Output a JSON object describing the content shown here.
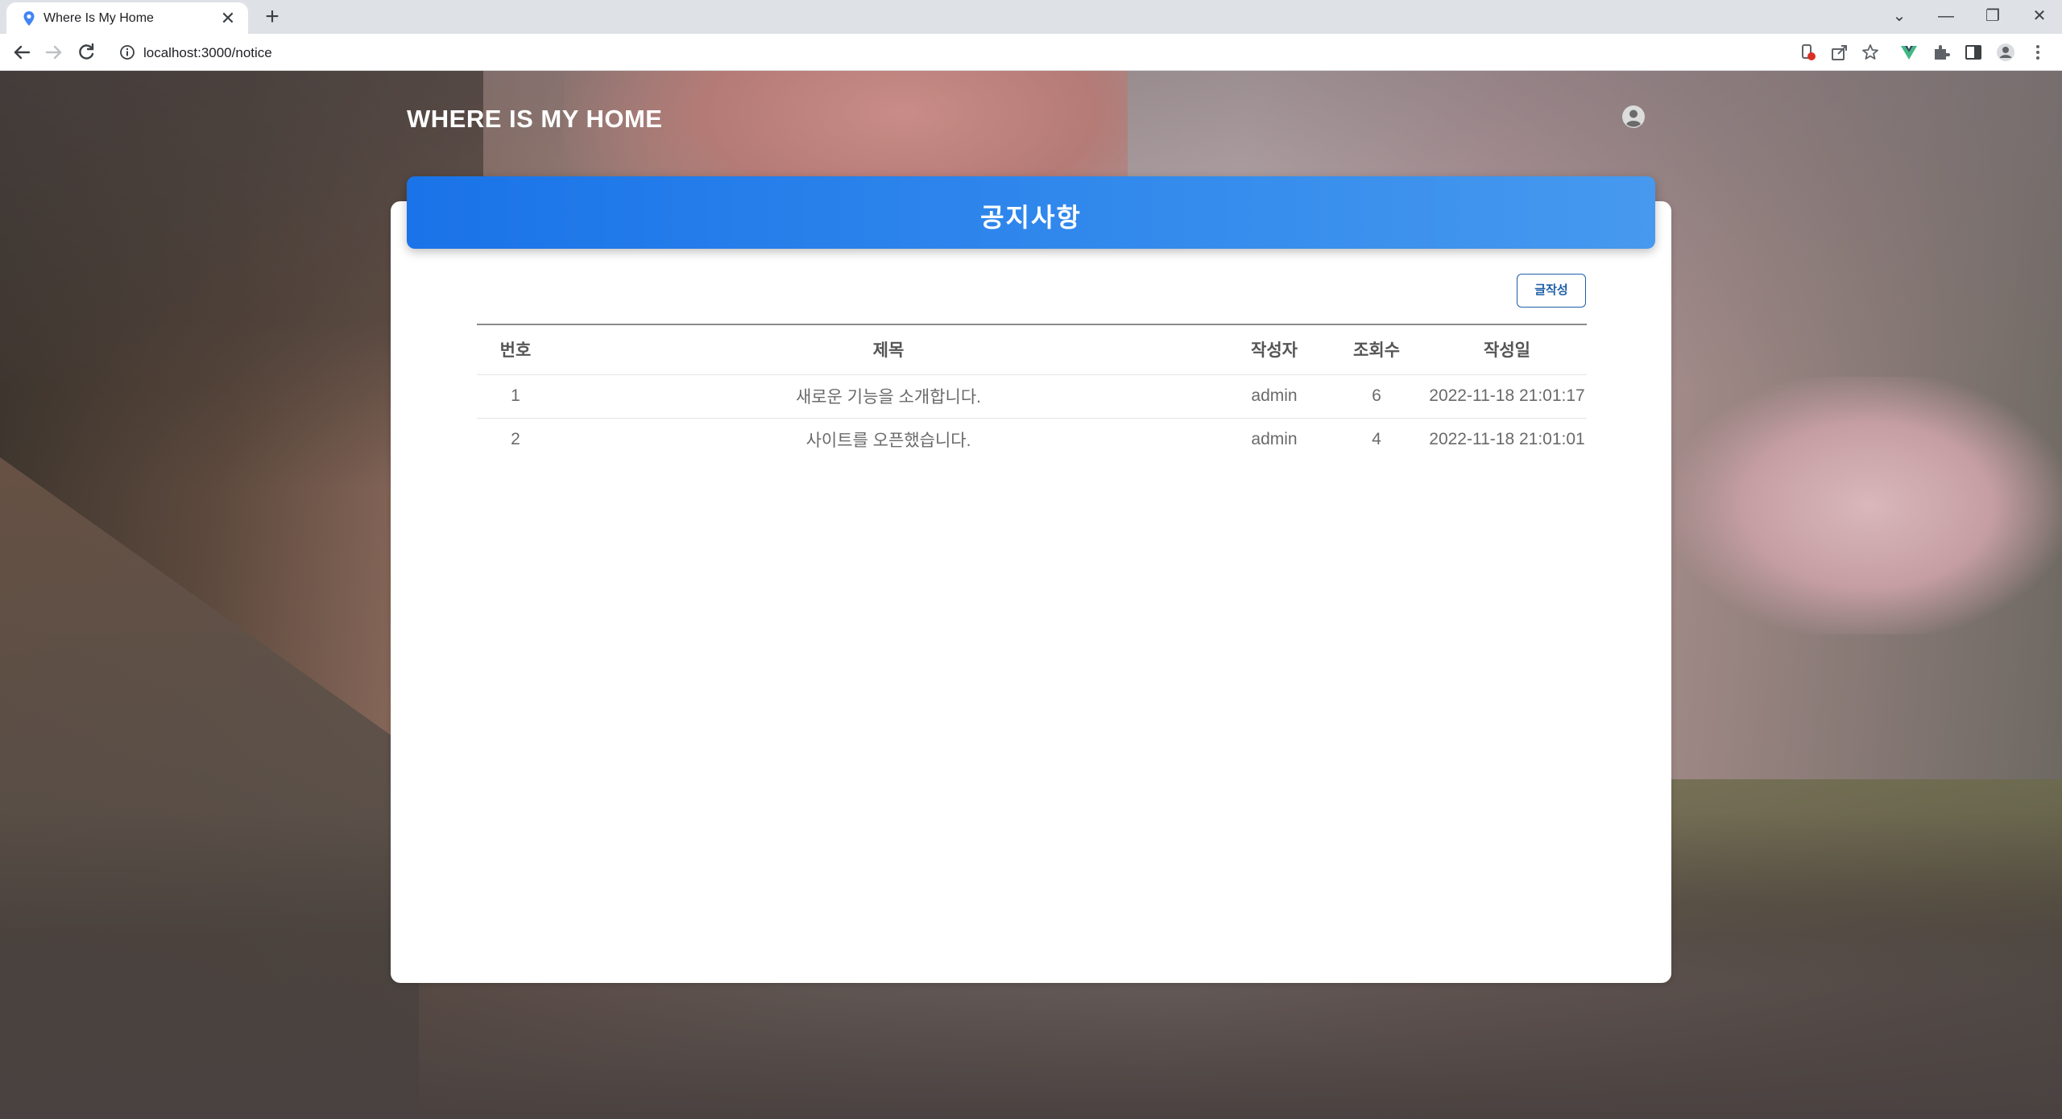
{
  "browser": {
    "tab_title": "Where Is My Home",
    "new_tab_label": "+",
    "close_tab_label": "✕",
    "url": "localhost:3000/notice",
    "window_controls": {
      "minimize": "—",
      "restore": "❐",
      "close": "✕",
      "tab_search": "⌄"
    }
  },
  "site": {
    "title": "WHERE IS MY HOME",
    "user_icon": "user-circle-icon"
  },
  "notice": {
    "header_title": "공지사항",
    "write_button_label": "글작성",
    "columns": {
      "no": "번호",
      "title": "제목",
      "author": "작성자",
      "hits": "조회수",
      "date": "작성일"
    },
    "rows": [
      {
        "no": "1",
        "title": "새로운 기능을 소개합니다.",
        "author": "admin",
        "hits": "6",
        "date": "2022-11-18 21:01:17"
      },
      {
        "no": "2",
        "title": "사이트를 오픈했습니다.",
        "author": "admin",
        "hits": "4",
        "date": "2022-11-18 21:01:01"
      }
    ]
  },
  "colors": {
    "header_blue": "#1a73e8",
    "button_border": "#1e5fa8"
  }
}
